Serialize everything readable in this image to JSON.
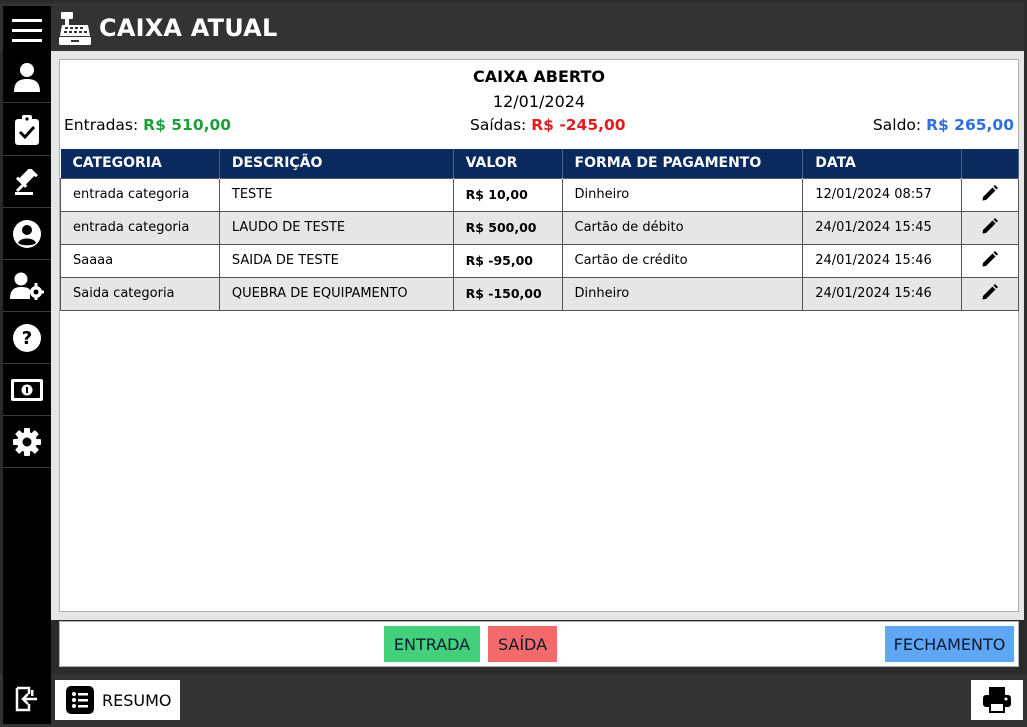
{
  "header": {
    "title": "CAIXA ATUAL",
    "title_icon": "cash-register-icon",
    "menu_icon": "hamburger-menu-icon"
  },
  "sidebar": {
    "items": [
      {
        "icon": "user-icon"
      },
      {
        "icon": "clipboard-check-icon"
      },
      {
        "icon": "gavel-icon"
      },
      {
        "icon": "user-circle-icon"
      },
      {
        "icon": "user-gear-icon"
      },
      {
        "icon": "question-circle-icon"
      },
      {
        "icon": "money-bill-icon"
      },
      {
        "icon": "gear-icon"
      }
    ],
    "logout_icon": "logout-icon"
  },
  "caixa": {
    "status": "CAIXA ABERTO",
    "date": "12/01/2024",
    "entradas_label": "Entradas:",
    "entradas_value": "R$ 510,00",
    "saidas_label": "Saídas:",
    "saidas_value": "R$ -245,00",
    "saldo_label": "Saldo:",
    "saldo_value": "R$ 265,00"
  },
  "table": {
    "headers": [
      "CATEGORIA",
      "DESCRIÇÃO",
      "VALOR",
      "FORMA DE PAGAMENTO",
      "DATA",
      ""
    ],
    "rows": [
      {
        "categoria": "entrada categoria",
        "descricao": "TESTE",
        "valor": "R$ 10,00",
        "forma": "Dinheiro",
        "data": "12/01/2024 08:57"
      },
      {
        "categoria": "entrada categoria",
        "descricao": "LAUDO DE TESTE",
        "valor": "R$ 500,00",
        "forma": "Cartão de débito",
        "data": "24/01/2024 15:45"
      },
      {
        "categoria": "Saaaa",
        "descricao": "SAIDA DE TESTE",
        "valor": "R$ -95,00",
        "forma": "Cartão de crédito",
        "data": "24/01/2024 15:46"
      },
      {
        "categoria": "Saida categoria",
        "descricao": "QUEBRA DE EQUIPAMENTO",
        "valor": "R$ -150,00",
        "forma": "Dinheiro",
        "data": "24/01/2024 15:46"
      }
    ]
  },
  "actions": {
    "entrada": "ENTRADA",
    "saida": "SAÍDA",
    "fechamento": "FECHAMENTO"
  },
  "footer": {
    "resumo": "RESUMO",
    "resumo_icon": "list-icon",
    "print_icon": "printer-icon"
  },
  "colors": {
    "positive": "#1e9e3a",
    "negative": "#e01e1e",
    "saldo": "#2f6fdd",
    "table_header": "#0a2a5e"
  }
}
